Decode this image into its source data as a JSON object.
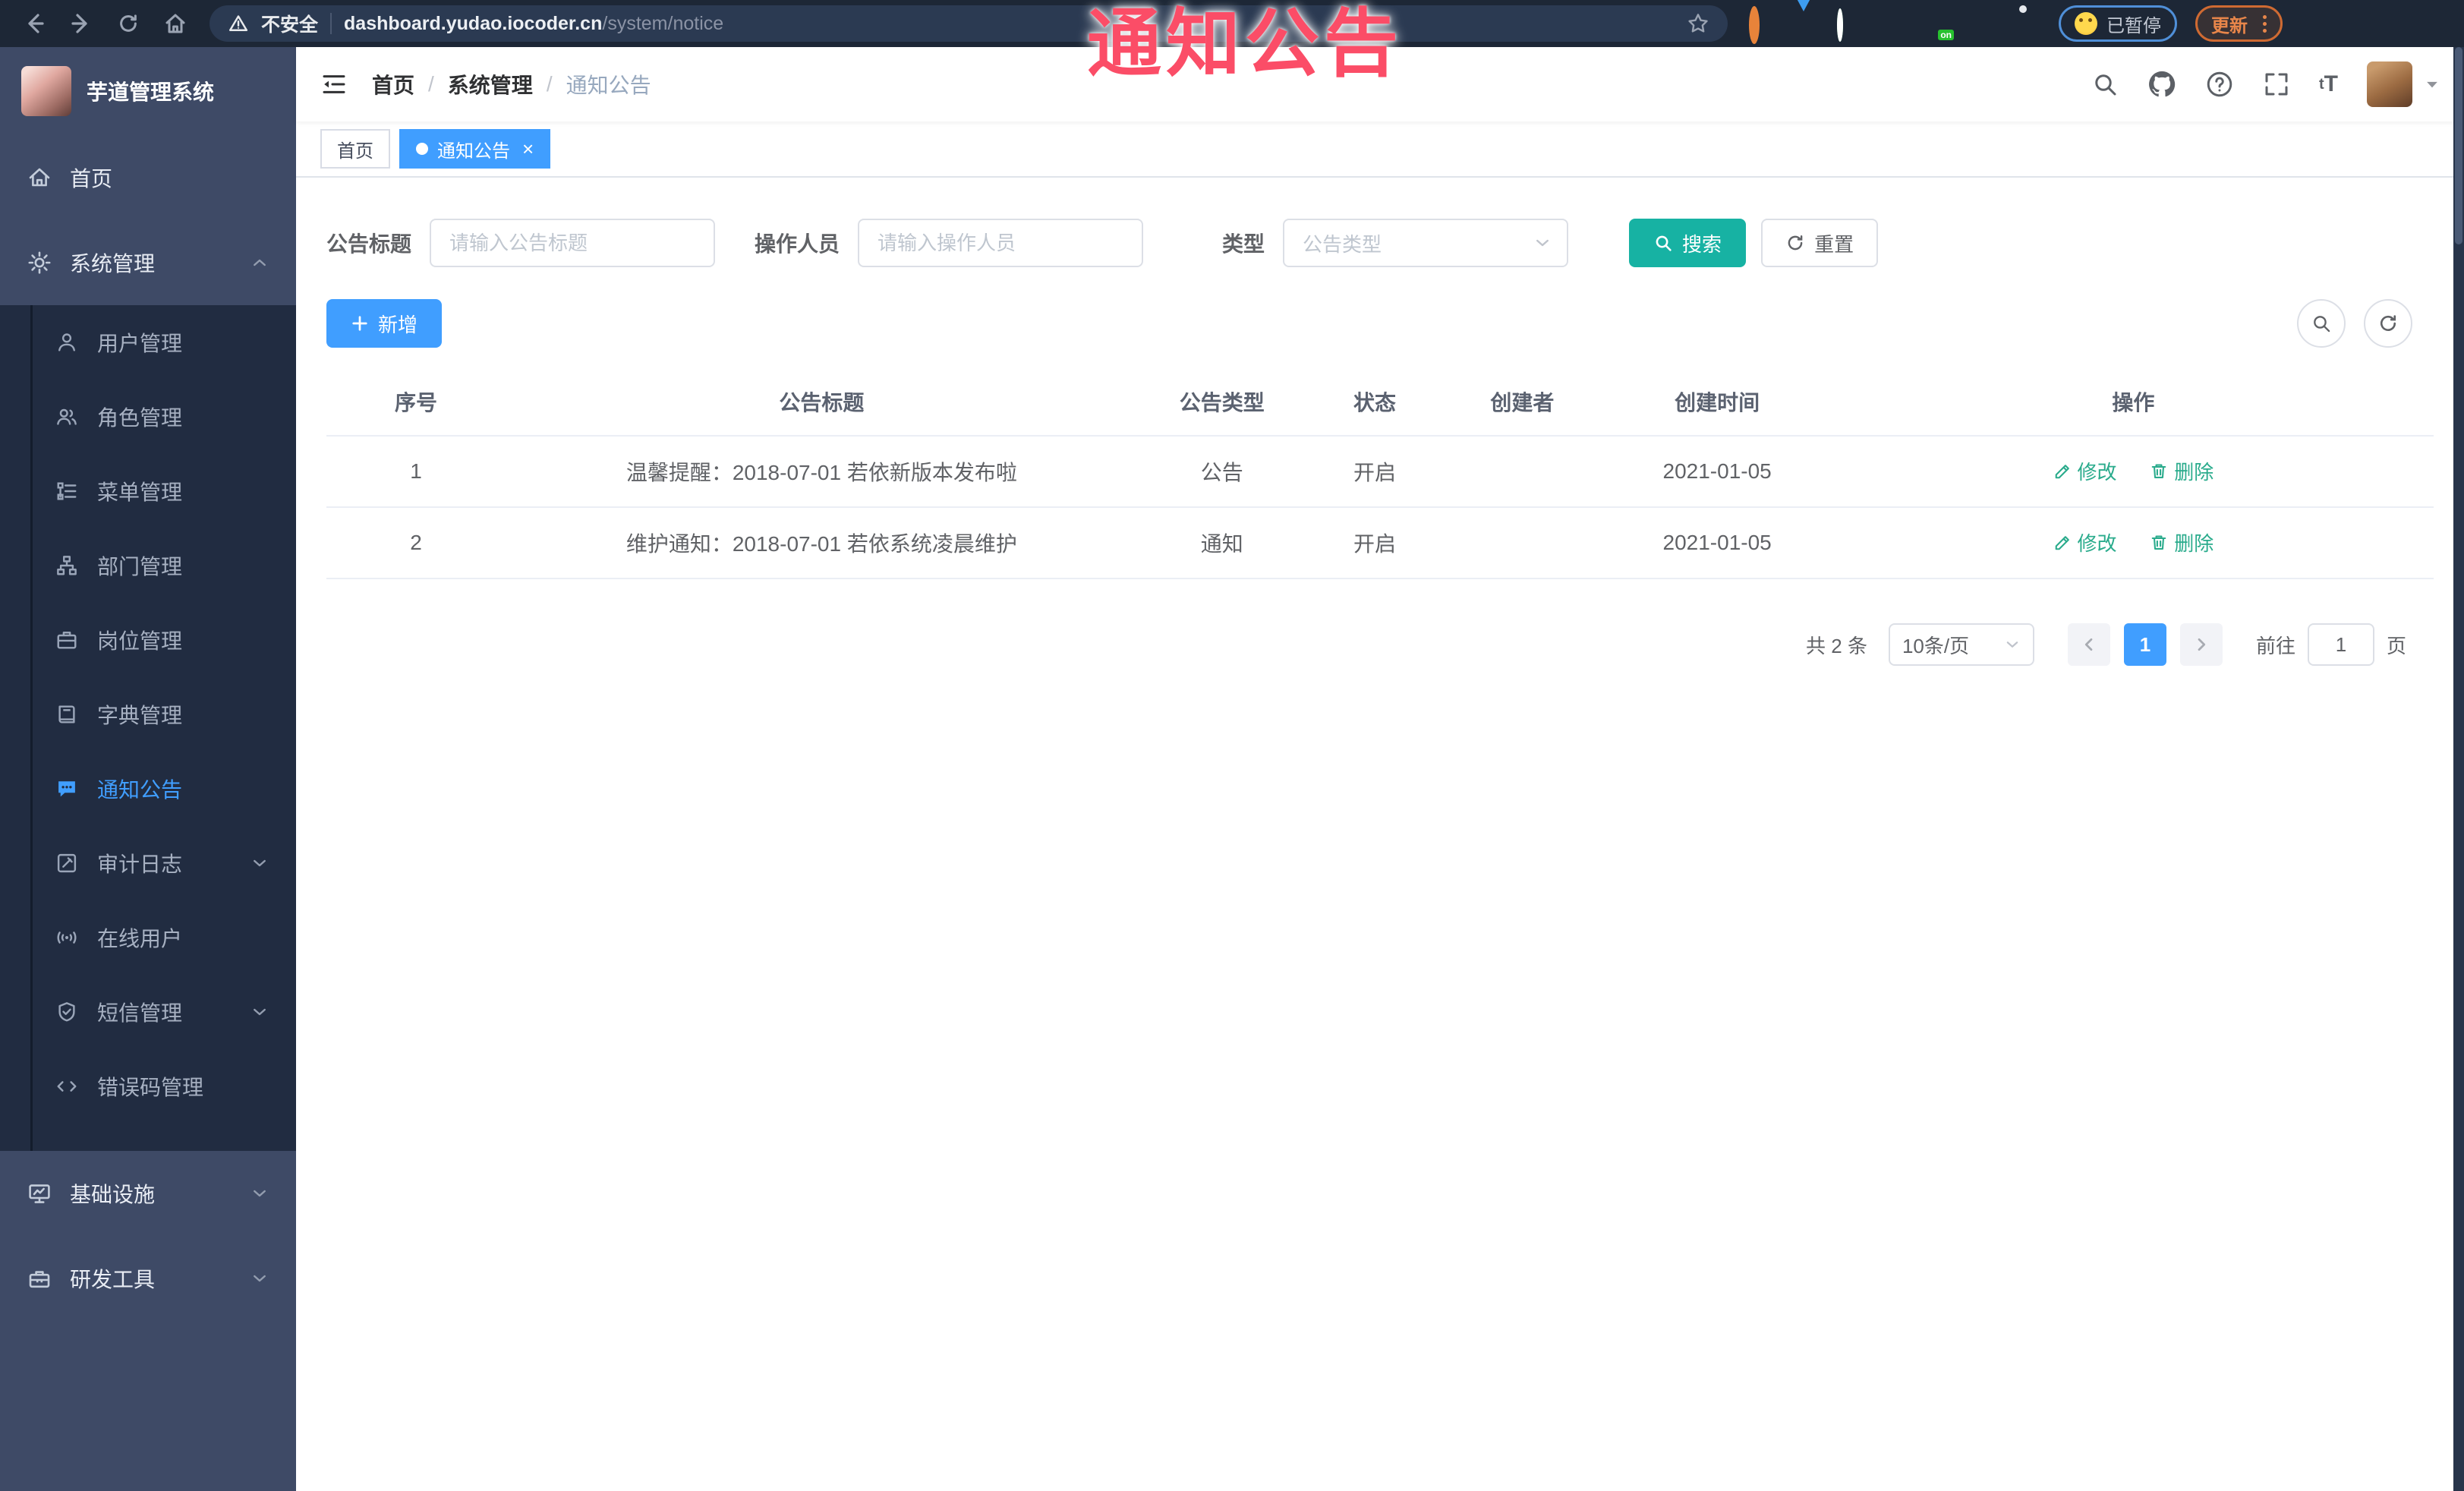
{
  "colors": {
    "accent_blue": "#409eff",
    "accent_teal": "#17b2a3",
    "link_green": "#2aab8c",
    "annotation_pink": "#fb4d67",
    "sidebar_bg": "#3e4a66",
    "submenu_bg": "#212c41",
    "browser_bg": "#1d2736",
    "pill_bg": "#2b3a52"
  },
  "annotation": {
    "text": "通知公告"
  },
  "browser": {
    "secure_label": "不安全",
    "url_host": "dashboard.yudao.iocoder.cn",
    "url_path": "/system/notice",
    "ext_on_badge": "on",
    "paused_label": "已暂停",
    "update_label": "更新"
  },
  "sidebar": {
    "title": "芋道管理系统",
    "items": [
      {
        "label": "首页"
      },
      {
        "label": "系统管理"
      },
      {
        "label": "用户管理"
      },
      {
        "label": "角色管理"
      },
      {
        "label": "菜单管理"
      },
      {
        "label": "部门管理"
      },
      {
        "label": "岗位管理"
      },
      {
        "label": "字典管理"
      },
      {
        "label": "通知公告"
      },
      {
        "label": "审计日志"
      },
      {
        "label": "在线用户"
      },
      {
        "label": "短信管理"
      },
      {
        "label": "错误码管理"
      },
      {
        "label": "基础设施"
      },
      {
        "label": "研发工具"
      }
    ]
  },
  "header": {
    "breadcrumb": [
      "首页",
      "系统管理",
      "通知公告"
    ],
    "font_size_icon_text": "tT"
  },
  "tags": [
    {
      "label": "首页"
    },
    {
      "label": "通知公告"
    }
  ],
  "filters": {
    "title_label": "公告标题",
    "title_placeholder": "请输入公告标题",
    "operator_label": "操作人员",
    "operator_placeholder": "请输入操作人员",
    "type_label": "类型",
    "type_placeholder": "公告类型",
    "search_label": "搜索",
    "reset_label": "重置"
  },
  "toolbar": {
    "add_label": "新增"
  },
  "table": {
    "columns": [
      "序号",
      "公告标题",
      "公告类型",
      "状态",
      "创建者",
      "创建时间",
      "操作"
    ],
    "edit_label": "修改",
    "delete_label": "删除",
    "rows": [
      {
        "no": "1",
        "title": "温馨提醒：2018-07-01 若依新版本发布啦",
        "type": "公告",
        "status": "开启",
        "creator": "",
        "created": "2021-01-05"
      },
      {
        "no": "2",
        "title": "维护通知：2018-07-01 若依系统凌晨维护",
        "type": "通知",
        "status": "开启",
        "creator": "",
        "created": "2021-01-05"
      }
    ]
  },
  "pagination": {
    "total": "共 2 条",
    "page_size": "10条/页",
    "current_page": "1",
    "goto_label": "前往",
    "goto_value": "1",
    "page_label": "页"
  }
}
